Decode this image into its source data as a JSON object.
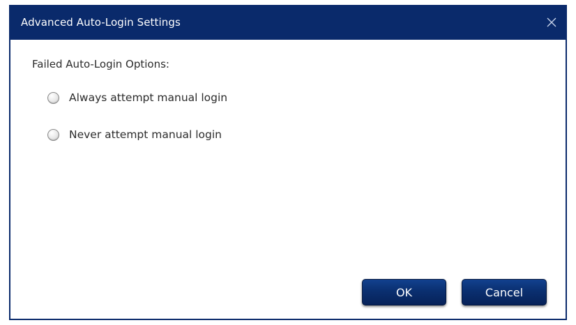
{
  "dialog": {
    "title": "Advanced Auto-Login Settings"
  },
  "section": {
    "label": "Failed Auto-Login Options:"
  },
  "options": [
    {
      "label": "Always attempt manual login",
      "selected": false
    },
    {
      "label": "Never attempt manual login",
      "selected": false
    }
  ],
  "buttons": {
    "ok_label": "OK",
    "cancel_label": "Cancel"
  },
  "colors": {
    "titlebar": "#0a2a6b",
    "button": "#0a2f70"
  },
  "icons": {
    "close": "close-icon"
  }
}
